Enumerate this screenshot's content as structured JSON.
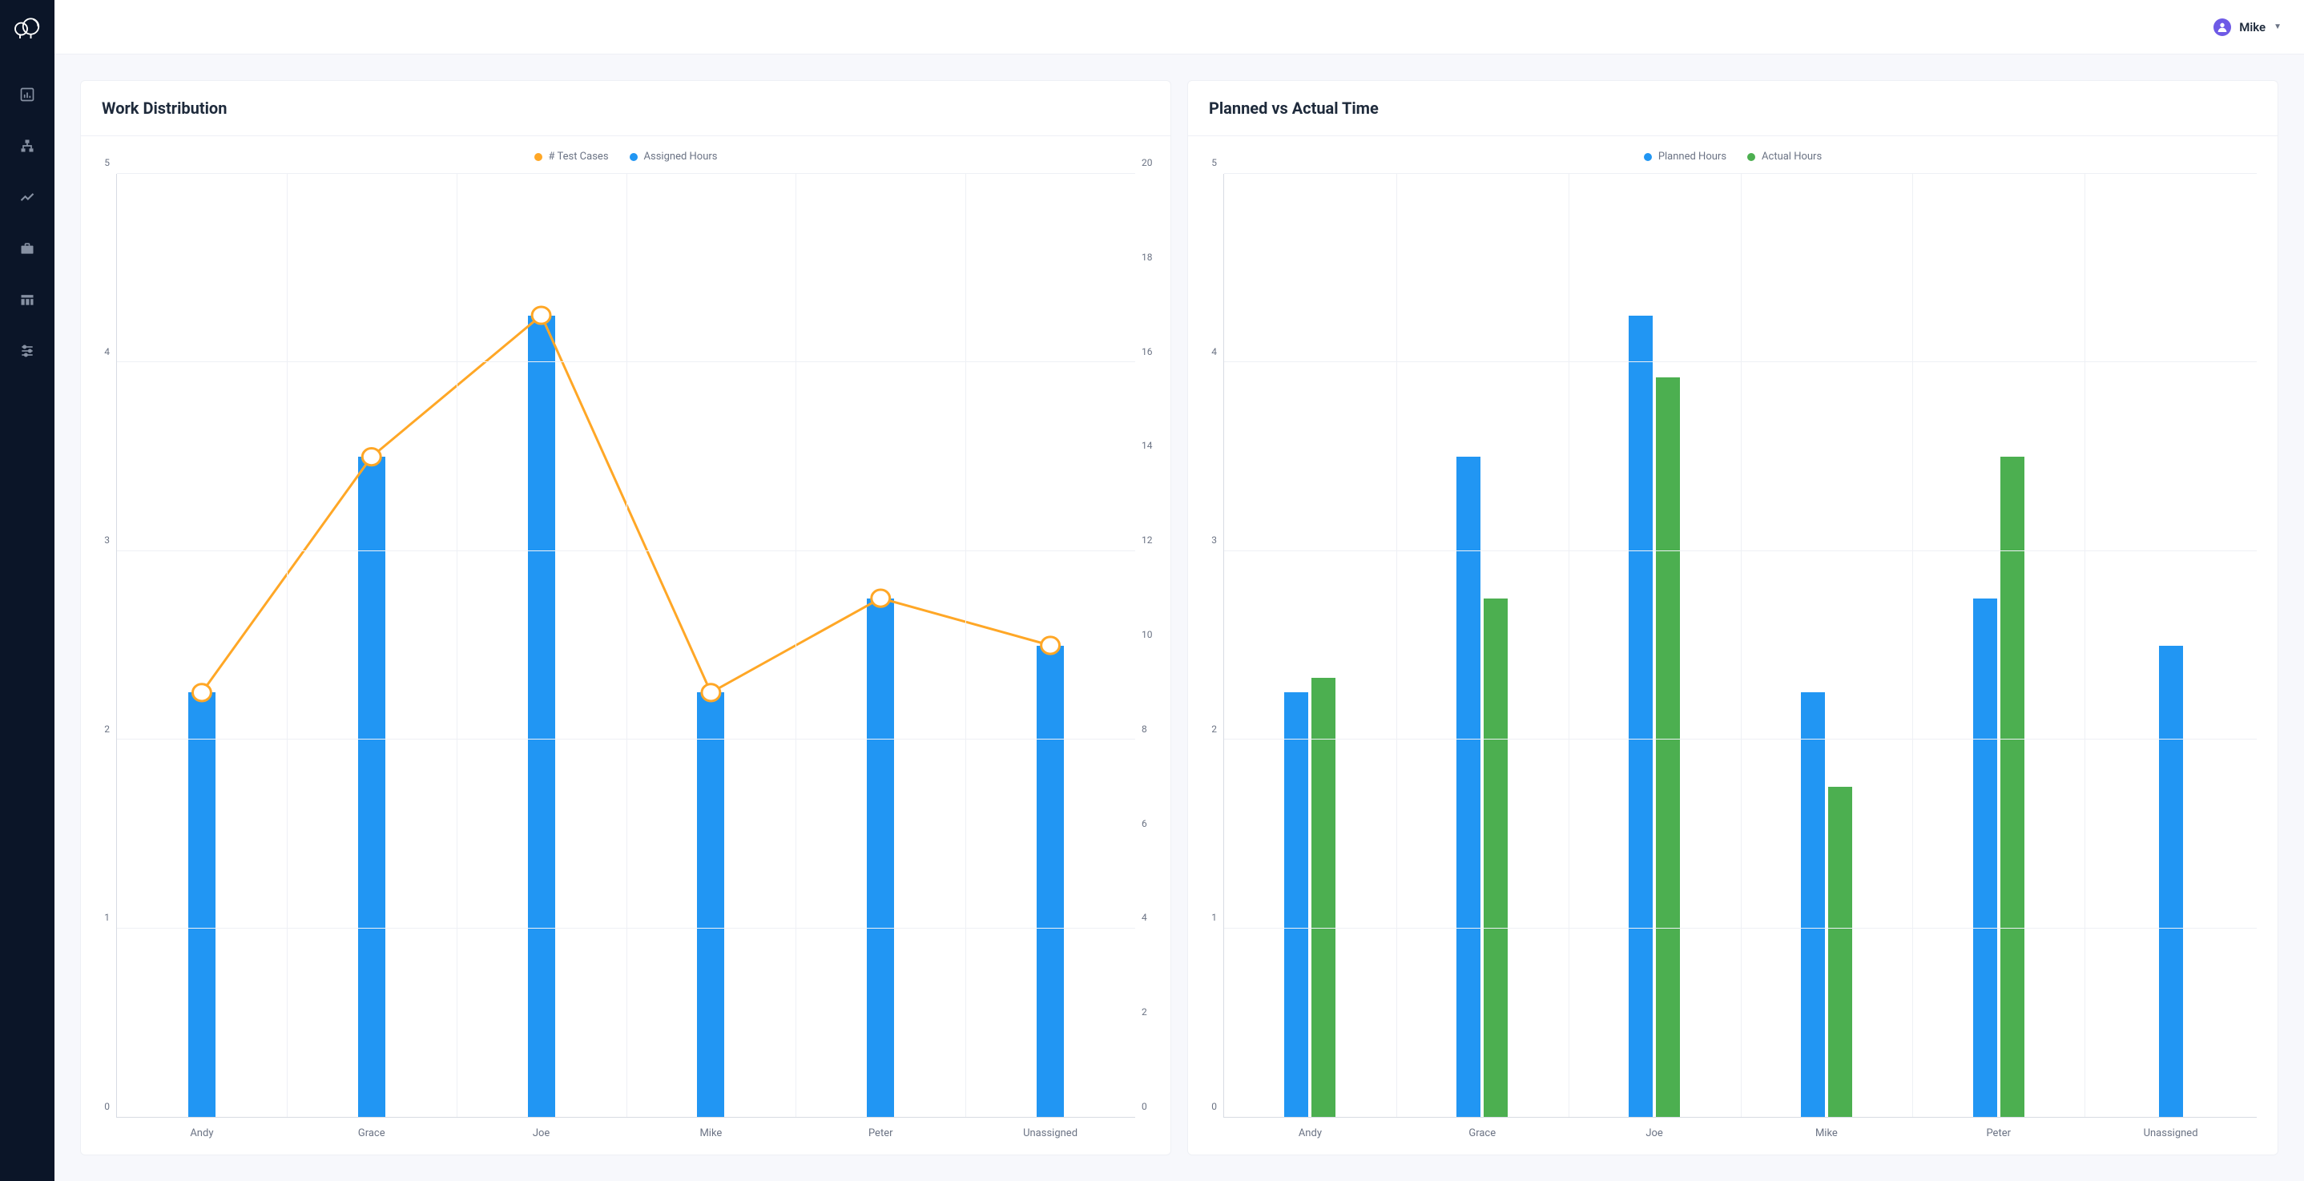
{
  "user": {
    "name": "Mike"
  },
  "sidebar_icons": [
    "bar-chart",
    "flow",
    "trend",
    "briefcase",
    "columns",
    "sliders"
  ],
  "chart_data": [
    {
      "id": "work-dist",
      "title": "Work Distribution",
      "type": "bar+line",
      "categories": [
        "Andy",
        "Grace",
        "Joe",
        "Mike",
        "Peter",
        "Unassigned"
      ],
      "series": [
        {
          "name": "# Test Cases",
          "type": "line",
          "axis": "right",
          "color": "#ffa726",
          "values": [
            9,
            14,
            17,
            9,
            11,
            10
          ]
        },
        {
          "name": "Assigned Hours",
          "type": "bar",
          "axis": "left",
          "color": "#2196f3",
          "values": [
            2.25,
            3.5,
            4.25,
            2.25,
            2.75,
            2.5
          ]
        }
      ],
      "y_left": {
        "min": 0,
        "max": 5,
        "ticks": [
          0,
          1,
          2,
          3,
          4,
          5
        ]
      },
      "y_right": {
        "min": 0,
        "max": 20,
        "ticks": [
          0,
          2,
          4,
          6,
          8,
          10,
          12,
          14,
          16,
          18,
          20
        ]
      }
    },
    {
      "id": "planned-actual",
      "title": "Planned vs Actual Time",
      "type": "bar",
      "categories": [
        "Andy",
        "Grace",
        "Joe",
        "Mike",
        "Peter",
        "Unassigned"
      ],
      "series": [
        {
          "name": "Planned Hours",
          "color": "#2196f3",
          "values": [
            2.25,
            3.5,
            4.25,
            2.25,
            2.75,
            2.5
          ]
        },
        {
          "name": "Actual Hours",
          "color": "#4caf50",
          "values": [
            2.33,
            2.75,
            3.92,
            1.75,
            3.5,
            0
          ]
        }
      ],
      "y_left": {
        "min": 0,
        "max": 5,
        "ticks": [
          0,
          1,
          2,
          3,
          4,
          5
        ]
      }
    }
  ]
}
